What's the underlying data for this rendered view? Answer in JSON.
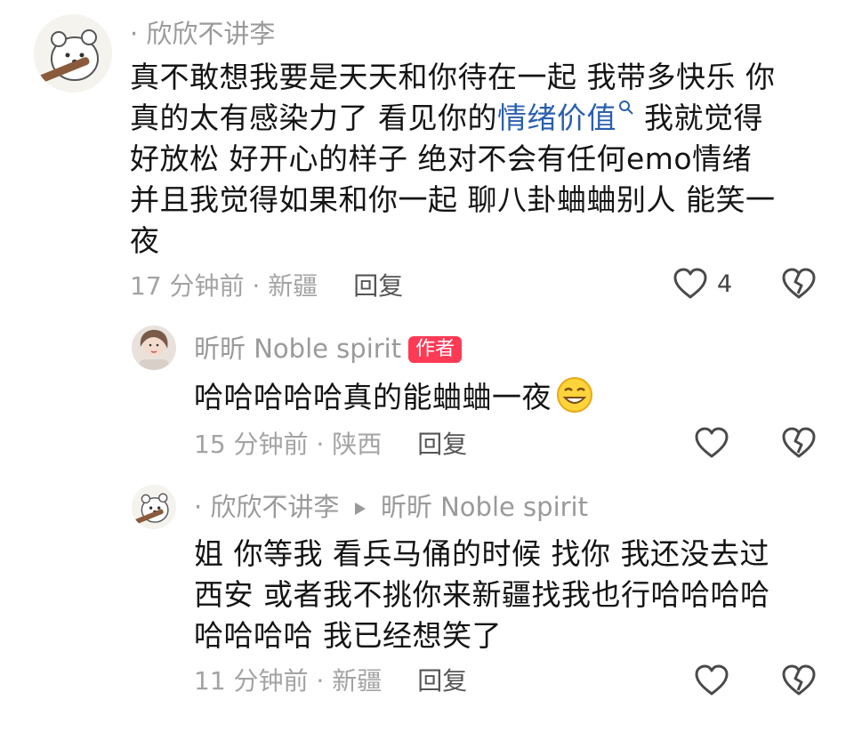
{
  "comments": [
    {
      "username": "· 欣欣不讲李",
      "lines": [
        "真不敢想我要是天天和你待在一起 我带多快乐 你",
        "真的太有感染力了 看见你的",
        "好放松 好开心的样子 绝对不会有任何emo情绪",
        "并且我觉得如果和你一起 聊八卦蛐蛐别人 能笑一",
        "夜"
      ],
      "link_text": "情绪价值",
      "line2_tail": " 我就觉得",
      "time": "17 分钟前 · 新疆",
      "reply": "回复",
      "likes": "4"
    },
    {
      "username": "昕昕 Noble spirit",
      "badge": "作者",
      "lines": [
        "哈哈哈哈哈真的能蛐蛐一夜"
      ],
      "time": "15 分钟前 · 陕西",
      "reply": "回复"
    },
    {
      "username": "· 欣欣不讲李",
      "reply_to": "昕昕 Noble spirit",
      "lines": [
        "姐 你等我 看兵马俑的时候 找你 我还没去过",
        "西安 或者我不挑你来新疆找我也行哈哈哈哈",
        "哈哈哈哈 我已经想笑了"
      ],
      "time": "11 分钟前 · 新疆",
      "reply": "回复"
    }
  ],
  "icons": {
    "like": "heart-outline-icon",
    "dislike": "broken-heart-icon",
    "search": "search-icon",
    "reply_arrow": "play-arrow-icon",
    "emoji": "grin-emoji-icon"
  }
}
